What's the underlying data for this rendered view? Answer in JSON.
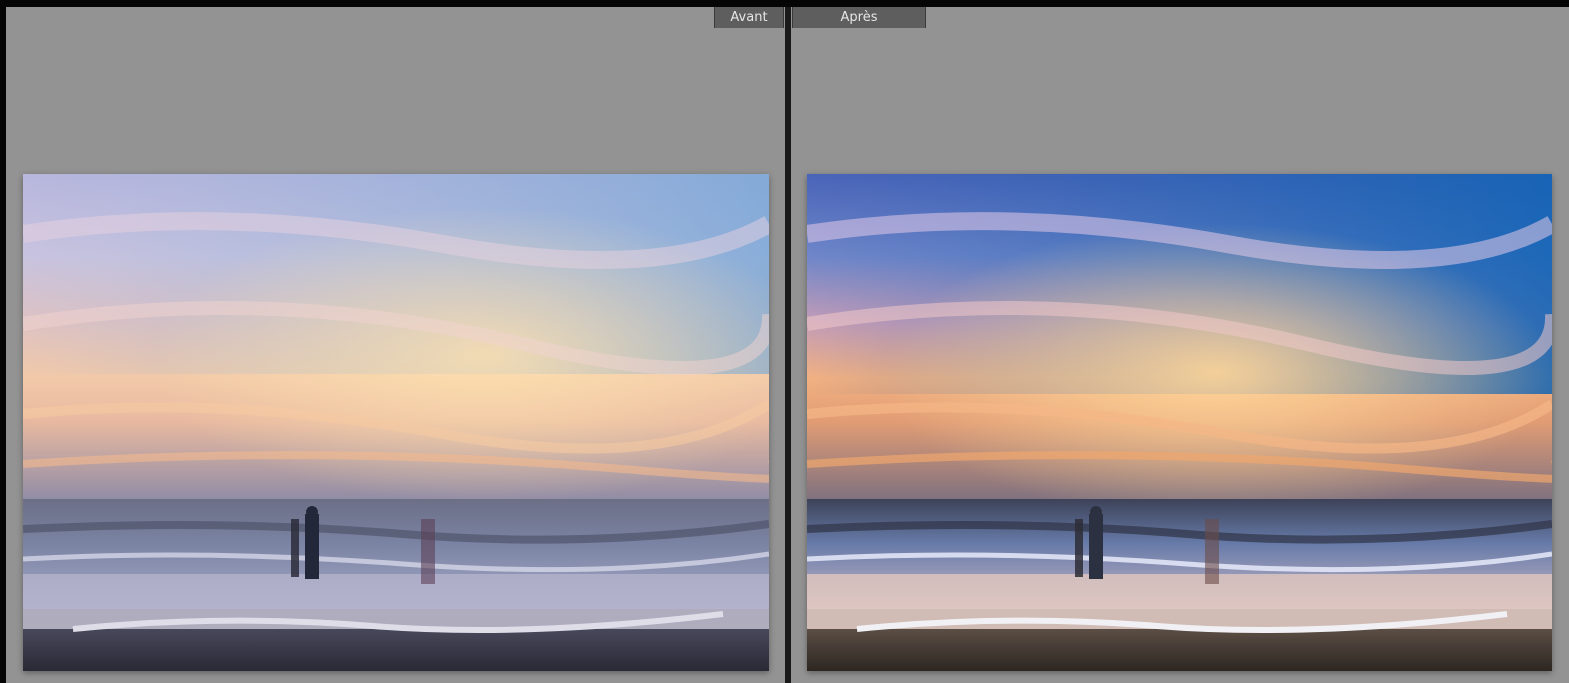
{
  "compare_view": {
    "before": {
      "label": "Avant",
      "image_description_icon": "beach-sunset-photo"
    },
    "after": {
      "label": "Après",
      "image_description_icon": "beach-sunset-photo"
    }
  },
  "colors": {
    "background_gray": "#939393",
    "label_bg": "#5e5e5e",
    "label_text": "#e6e6e6",
    "divider": "#1a1a1a"
  }
}
